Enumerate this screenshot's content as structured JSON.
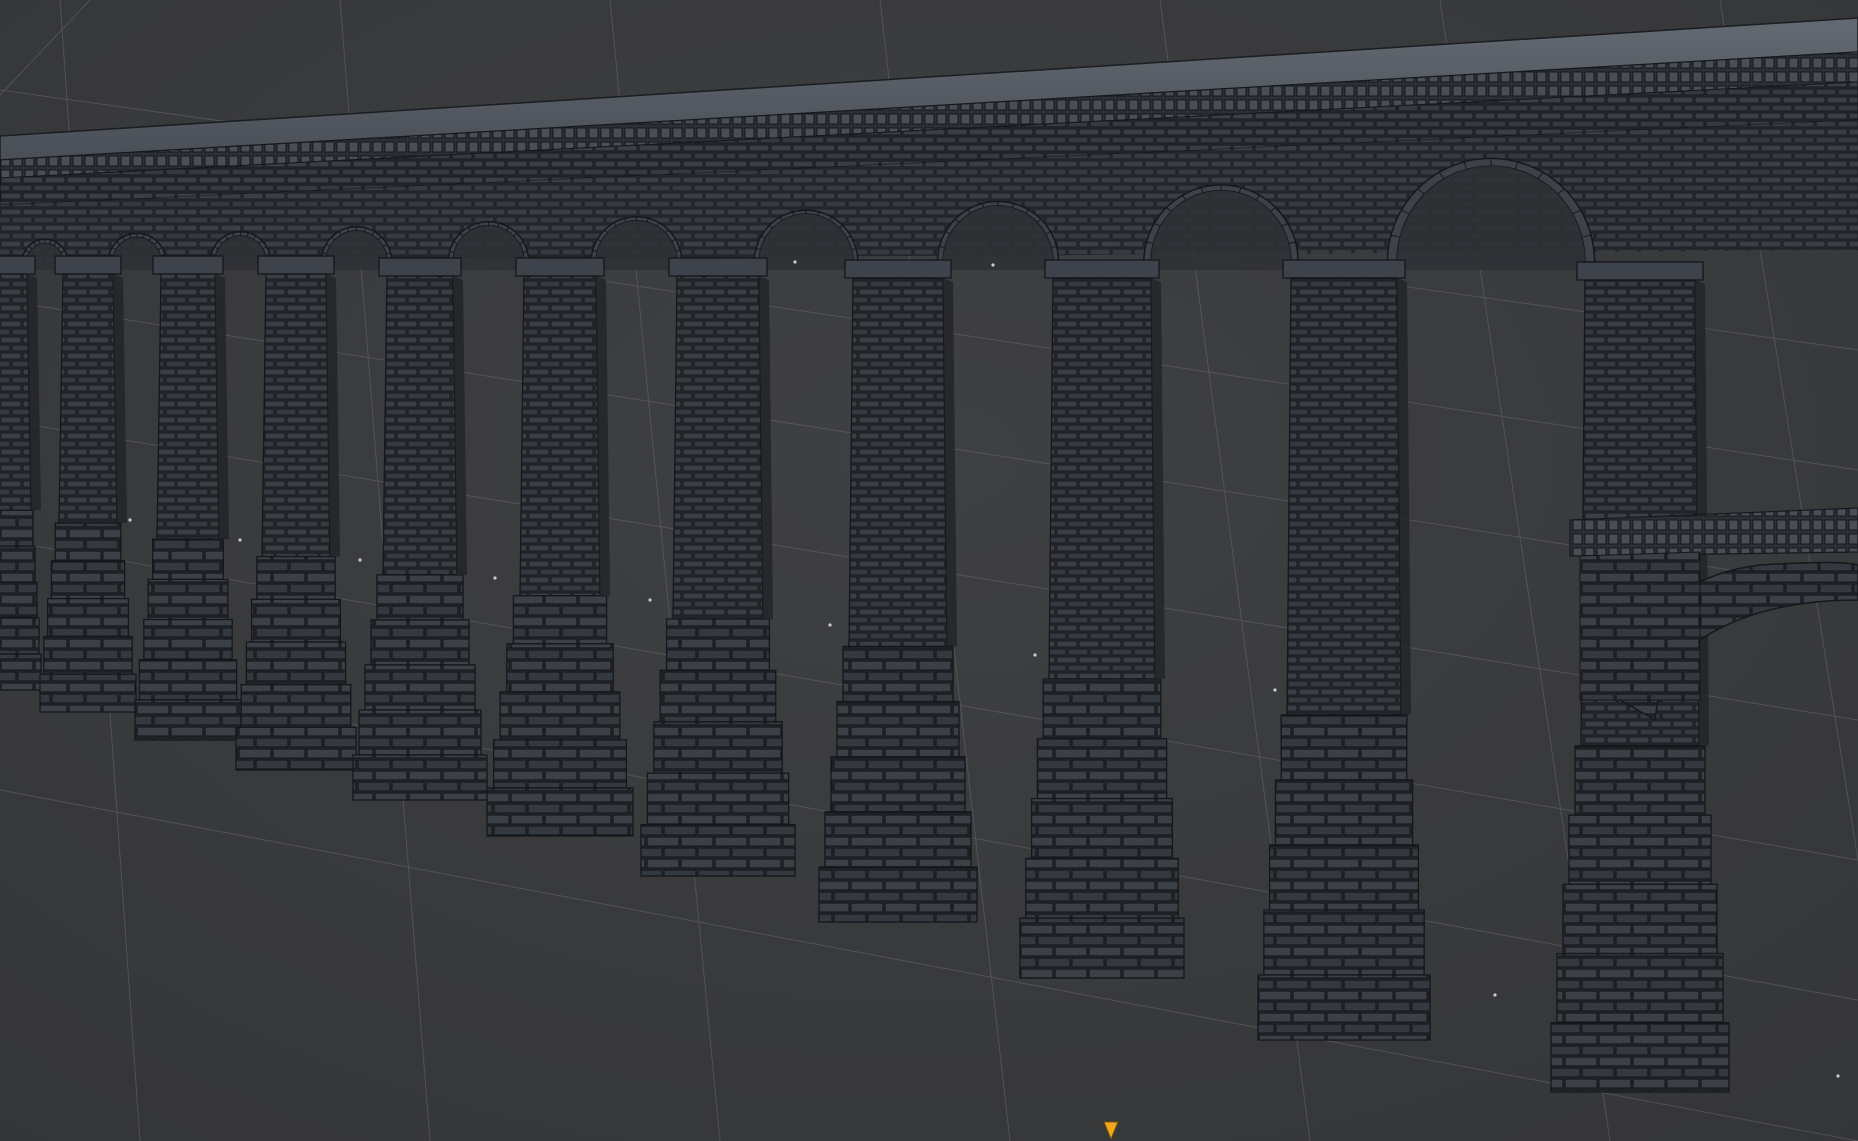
{
  "viewport": {
    "background_color": "#3b3b3d",
    "grid_color": "#6a6c70",
    "model_fill_color": "#2b2e33",
    "model_light_color": "#5b6068",
    "wire_color": "#14171b",
    "accent_color": "#f0a81c"
  },
  "scene": {
    "object": "aqueduct-model",
    "pillar_count": 12,
    "display_mode": "wireframe-on-shaded"
  },
  "icons": {
    "pivot_marker": "origin-marker-icon"
  }
}
